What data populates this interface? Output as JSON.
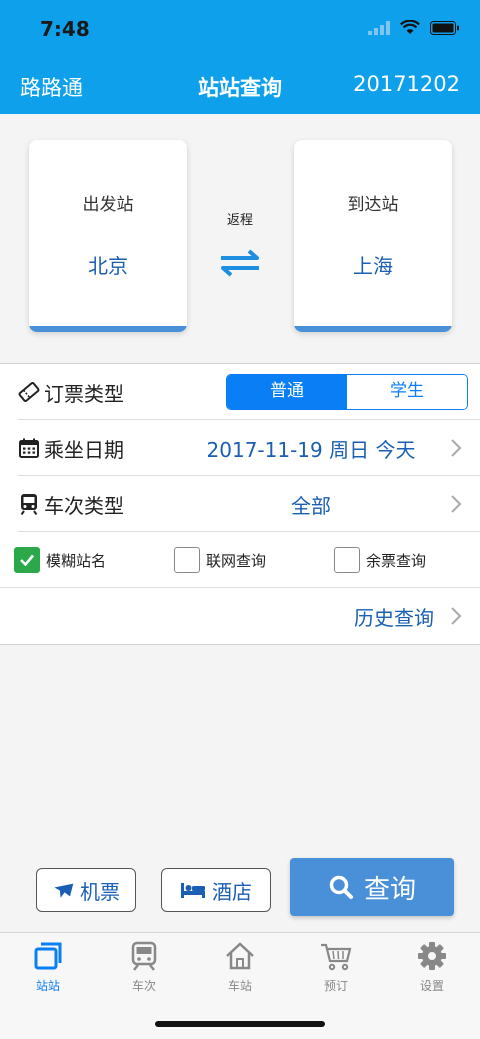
{
  "status": {
    "time": "7:48"
  },
  "nav": {
    "left": "路路通",
    "title": "站站查询",
    "right": "20171202"
  },
  "stations": {
    "from_label": "出发站",
    "from_name": "北京",
    "round_trip": "返程",
    "to_label": "到达站",
    "to_name": "上海"
  },
  "form": {
    "ticket_type_label": "订票类型",
    "ticket_options": [
      "普通",
      "学生"
    ],
    "ticket_selected": "普通",
    "date_label": "乘坐日期",
    "date_value": "2017-11-19 周日 今天",
    "train_type_label": "车次类型",
    "train_type_value": "全部",
    "checkboxes": [
      {
        "label": "模糊站名",
        "checked": true
      },
      {
        "label": "联网查询",
        "checked": false
      },
      {
        "label": "余票查询",
        "checked": false
      }
    ],
    "history_label": "历史查询"
  },
  "actions": {
    "flight": "机票",
    "hotel": "酒店",
    "search": "查询"
  },
  "tabs": [
    {
      "label": "站站",
      "icon": "station-to-station-icon",
      "active": true
    },
    {
      "label": "车次",
      "icon": "train-icon",
      "active": false
    },
    {
      "label": "车站",
      "icon": "house-icon",
      "active": false
    },
    {
      "label": "预订",
      "icon": "cart-icon",
      "active": false
    },
    {
      "label": "设置",
      "icon": "gear-icon",
      "active": false
    }
  ],
  "colors": {
    "header": "#0ea0eb",
    "accent": "#0a7ff5",
    "link": "#1a5fb4",
    "search_button": "#4a90d9",
    "checkbox_checked": "#2ba84a"
  }
}
